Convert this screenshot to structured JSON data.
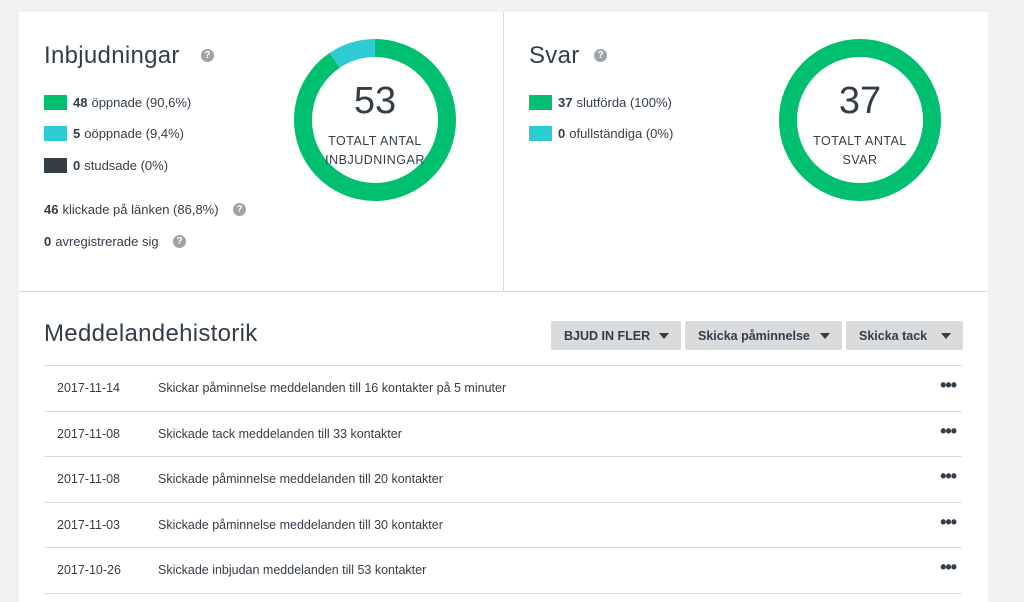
{
  "invitations": {
    "title": "Inbjudningar",
    "legend": [
      {
        "count": "48",
        "label": "öppnade (90,6%)",
        "color": "#00bf6f"
      },
      {
        "count": "5",
        "label": "oöppnade (9,4%)",
        "color": "#2dccd3"
      },
      {
        "count": "0",
        "label": "studsade (0%)",
        "color": "#333e48"
      }
    ],
    "clicked": {
      "count": "46",
      "label": "klickade på länken (86,8%)"
    },
    "unsubscribed": {
      "count": "0",
      "label": "avregistrerade sig"
    },
    "donut": {
      "number": "53",
      "label_line1": "TOTALT ANTAL",
      "label_line2": "INBJUDNINGAR",
      "segments": [
        {
          "name": "öppnade",
          "value": 48,
          "color": "#00bf6f"
        },
        {
          "name": "oöppnade",
          "value": 5,
          "color": "#2dccd3"
        }
      ]
    }
  },
  "responses": {
    "title": "Svar",
    "legend": [
      {
        "count": "37",
        "label": "slutförda (100%)",
        "color": "#00bf6f"
      },
      {
        "count": "0",
        "label": "ofullständiga (0%)",
        "color": "#2dccd3"
      }
    ],
    "donut": {
      "number": "37",
      "label_line1": "TOTALT ANTAL",
      "label_line2": "SVAR",
      "segments": [
        {
          "name": "slutförda",
          "value": 37,
          "color": "#00bf6f"
        },
        {
          "name": "ofullständiga",
          "value": 0,
          "color": "#2dccd3"
        }
      ]
    }
  },
  "history": {
    "title": "Meddelandehistorik",
    "buttons": {
      "invite_more": "BJUD IN FLER",
      "send_reminder": "Skicka påminnelse",
      "send_thanks": "Skicka tack"
    },
    "rows": [
      {
        "date": "2017-11-14",
        "text": "Skickar påminnelse meddelanden till 16 kontakter på 5 minuter"
      },
      {
        "date": "2017-11-08",
        "text": "Skickade tack meddelanden till 33 kontakter"
      },
      {
        "date": "2017-11-08",
        "text": "Skickade påminnelse meddelanden till 20 kontakter"
      },
      {
        "date": "2017-11-03",
        "text": "Skickade påminnelse meddelanden till 30 kontakter"
      },
      {
        "date": "2017-10-26",
        "text": "Skickade inbjudan meddelanden till 53 kontakter"
      }
    ],
    "more_glyph": "•••"
  },
  "help_glyph": "?"
}
